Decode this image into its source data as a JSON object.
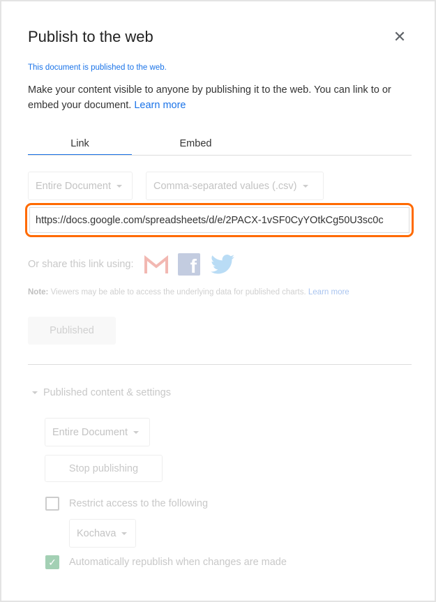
{
  "dialog": {
    "title": "Publish to the web",
    "status": "This document is published to the web.",
    "description": "Make your content visible to anyone by publishing it to the web. You can link to or embed your document.",
    "learn_more": "Learn more",
    "tabs": [
      {
        "label": "Link",
        "active": true
      },
      {
        "label": "Embed",
        "active": false
      }
    ],
    "scope_select": "Entire Document",
    "format_select": "Comma-separated values (.csv)",
    "url": "https://docs.google.com/spreadsheets/d/e/2PACX-1vSF0CyYOtkCg50U3sc0c",
    "share_label": "Or share this link using:",
    "share_icons": [
      "gmail-icon",
      "facebook-icon",
      "twitter-icon"
    ],
    "note_bold": "Note:",
    "note_text": "Viewers may be able to access the underlying data for published charts.",
    "note_link": "Learn more",
    "published_button": "Published",
    "settings": {
      "header": "Published content & settings",
      "scope_select": "Entire Document",
      "stop_button": "Stop publishing",
      "restrict_label": "Restrict access to the following",
      "restrict_checked": false,
      "org_select": "Kochava",
      "republish_label": "Automatically republish when changes are made",
      "republish_checked": true
    }
  },
  "colors": {
    "accent": "#1a73e8",
    "highlight": "#ff6a00"
  }
}
